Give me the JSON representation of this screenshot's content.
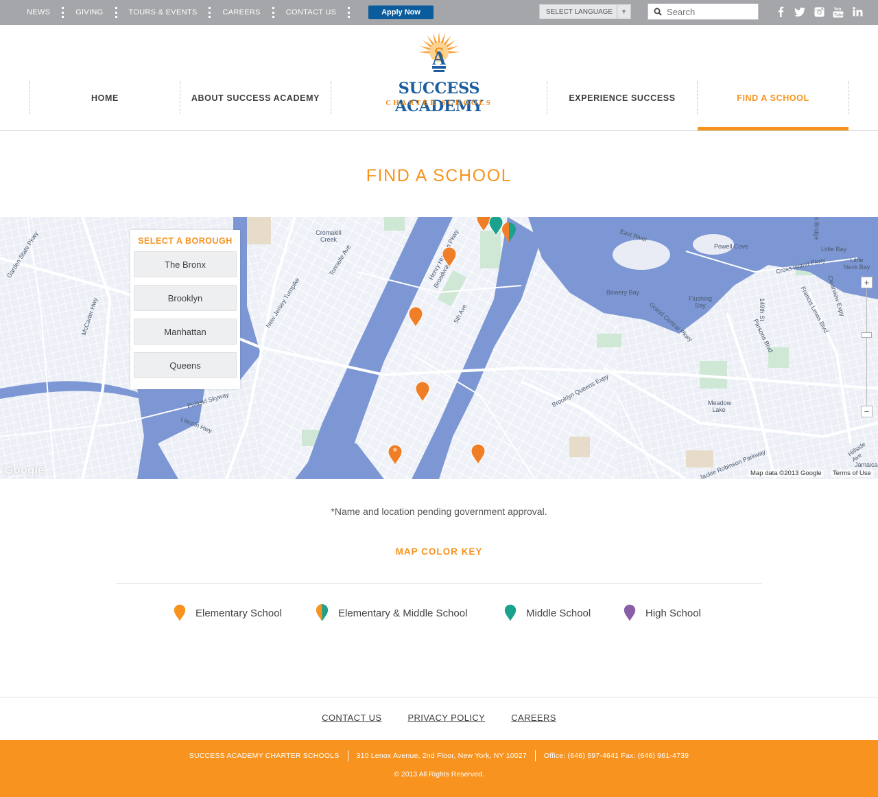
{
  "utility_nav": {
    "items": [
      "NEWS",
      "GIVING",
      "TOURS & EVENTS",
      "CAREERS",
      "CONTACT US"
    ],
    "apply_label": "Apply Now",
    "language_label": "SELECT LANGUAGE",
    "search_placeholder": "Search",
    "social_icons": [
      "facebook-icon",
      "twitter-icon",
      "instagram-icon",
      "youtube-icon",
      "linkedin-icon"
    ]
  },
  "main_nav": {
    "items": [
      "HOME",
      "ABOUT SUCCESS ACADEMY",
      "EXPERIENCE SUCCESS",
      "FIND A SCHOOL"
    ],
    "active": "FIND A SCHOOL"
  },
  "logo": {
    "name": "SUCCESS ACADEMY",
    "subtitle": "CHARTER SCHOOLS"
  },
  "page": {
    "title": "FIND A SCHOOL"
  },
  "map": {
    "borough_heading": "SELECT A BOROUGH",
    "boroughs": [
      "The Bronx",
      "Brooklyn",
      "Manhattan",
      "Queens"
    ],
    "labels": [
      "East River",
      "Powell Cove",
      "Little Bay",
      "Little Neck Bay",
      "Cross Island Pkwy",
      "Bowery Bay",
      "Flushing Bay",
      "Grand Central Pkwy",
      "Brooklyn Queens Expy",
      "Meadow Lake",
      "Pulaski Skyway",
      "Lincoln Hwy",
      "Henry Hudson Pkwy",
      "Broadway",
      "5th Ave",
      "Tonnelle Ave",
      "New Jersey Turnpike",
      "McCarter Hwy",
      "Garden State Pkwy",
      "Cromakill Creek",
      "Francis Lewis Blvd",
      "Clearview Expy",
      "Parsons Blvd",
      "149th St",
      "Jackie Robinson Parkway",
      "Hillside Ave",
      "Jamaica",
      "Neck Bridge"
    ],
    "attribution": "Map data ©2013 Google",
    "terms": "Terms of Use",
    "google_mark": "Google"
  },
  "note": "*Name and location pending government approval.",
  "map_key": {
    "title": "MAP COLOR KEY",
    "items": [
      {
        "label": "Elementary School",
        "icon": "elementary-pin-icon"
      },
      {
        "label": "Elementary & Middle School",
        "icon": "elementary-middle-pin-icon"
      },
      {
        "label": "Middle School",
        "icon": "middle-pin-icon"
      },
      {
        "label": "High School",
        "icon": "high-pin-icon"
      }
    ]
  },
  "colors": {
    "accent": "#f7931e",
    "elementary": "#f07e26",
    "middle": "#1aa28f",
    "high": "#8a5ea6",
    "brand_blue": "#1b5d9e",
    "apply_blue": "#0b5c9d"
  },
  "footer": {
    "links": [
      "CONTACT US",
      "PRIVACY POLICY",
      "CAREERS"
    ],
    "org": "SUCCESS ACADEMY CHARTER SCHOOLS",
    "address": "310 Lenox Avenue, 2nd Floor, New York, NY 10027",
    "phone": "Office: (646) 597-4641 Fax: (646) 961-4739",
    "copyright": "© 2013 All Rights Reserved."
  }
}
